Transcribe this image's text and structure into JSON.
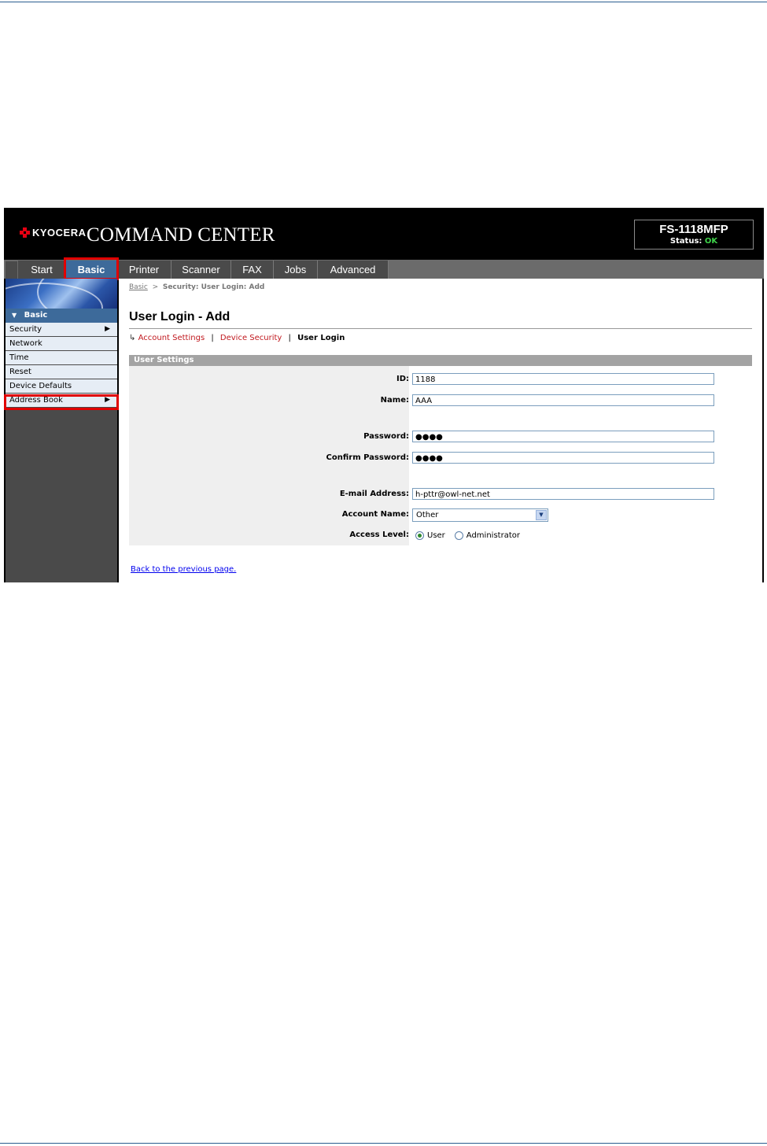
{
  "brand": {
    "logo_text": "KYOCERA",
    "app_title": "COMMAND CENTER"
  },
  "device": {
    "model": "FS-1118MFP",
    "status_label": "Status:",
    "status_value": "OK"
  },
  "nav": {
    "tabs": [
      "Start",
      "Basic",
      "Printer",
      "Scanner",
      "FAX",
      "Jobs",
      "Advanced"
    ],
    "active": "Basic"
  },
  "sidebar": {
    "header": "Basic",
    "items": [
      "Security",
      "Network",
      "Time",
      "Reset",
      "Device Defaults",
      "Address Book"
    ]
  },
  "breadcrumb": {
    "root": "Basic",
    "separator": ">",
    "current": "Security: User Login: Add"
  },
  "page": {
    "title": "User Login - Add"
  },
  "subnav": {
    "links": [
      "Account Settings",
      "Device Security"
    ],
    "current": "User Login"
  },
  "form": {
    "section": "User Settings",
    "id_label": "ID:",
    "id_value": "1188",
    "name_label": "Name:",
    "name_value": "AAA",
    "password_label": "Password:",
    "password_value": "●●●●",
    "confirm_label": "Confirm Password:",
    "confirm_value": "●●●●",
    "email_label": "E-mail Address:",
    "email_value": "h-pttr@owl-net.net",
    "account_label": "Account Name:",
    "account_value": "Other",
    "access_label": "Access Level:",
    "access_options": [
      "User",
      "Administrator"
    ],
    "access_selected": "User"
  },
  "back_link": "Back to the previous page.",
  "colors": {
    "accent": "#3d6a9a",
    "highlight": "#e00000",
    "link_red": "#c0181e",
    "status_ok": "#3fd34a"
  }
}
